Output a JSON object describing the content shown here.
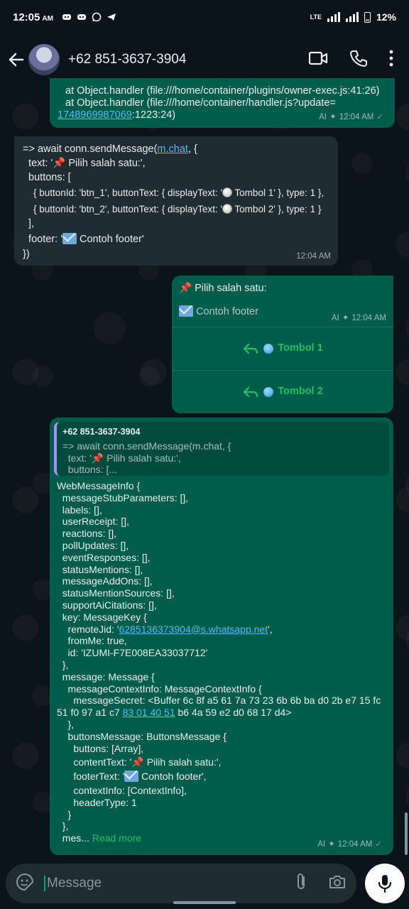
{
  "status_bar": {
    "time": "12:05",
    "ampm": "AM",
    "network": "LTE",
    "battery": "12%"
  },
  "header": {
    "contact": "+62 851-3637-3904"
  },
  "msg1": {
    "lines": [
      "at Object.handler (file:///home/container/plugins/owner-exec.js:41:26)",
      "at Object.handler (file:///home/container/handler.js?update="
    ],
    "link": "1748969987069",
    "suffix": ":1223:24)",
    "ai": "AI",
    "time": "12:04 AM"
  },
  "msg2": {
    "line1_prefix": "=> await conn.sendMessage(",
    "line1_link": "m.chat",
    "line1_suffix": ", {",
    "line2_a": "  text: '",
    "line2_b": " Pilih salah satu:',",
    "line3": "  buttons: [",
    "line4_a": "    { buttonId: 'btn_1', buttonText: { displayText: '",
    "line4_b": " Tombol 1' }, type: 1 },",
    "line5_a": "    { buttonId: 'btn_2', buttonText: { displayText: '",
    "line5_b": " Tombol 2' }, type: 1 }",
    "line6": "  ],",
    "line7_a": "  footer: '",
    "line7_b": " Contoh footer'",
    "line8": "})",
    "time": "12:04 AM"
  },
  "msg3": {
    "text": "Pilih salah satu:",
    "footer": "Contoh footer",
    "ai": "AI",
    "time": "12:04 AM",
    "button1": "Tombol 1",
    "button2": "Tombol 2"
  },
  "msg4": {
    "quote_author": "+62 851-3637-3904",
    "quote_line1": "=> await conn.sendMessage(m.chat, {",
    "quote_line2_a": "  text: '",
    "quote_line2_b": " Pilih salah satu:',",
    "quote_line3": "  buttons: [...",
    "body": [
      "WebMessageInfo {",
      "  messageStubParameters: [],",
      "  labels: [],",
      "  userReceipt: [],",
      "  reactions: [],",
      "  pollUpdates: [],",
      "  eventResponses: [],",
      "  statusMentions: [],",
      "  messageAddOns: [],",
      "  statusMentionSources: [],",
      "  supportAiCitations: [],",
      "  key: MessageKey {"
    ],
    "remote_prefix": "    remoteJid: '",
    "remote_link": "6285136373904@s.whatsapp.net",
    "remote_suffix": "',",
    "body2": [
      "    fromMe: true,",
      "    id: 'IZUMI-F7E008EA33037712'",
      "  },",
      "  message: Message {",
      "    messageContextInfo: MessageContextInfo {",
      "      messageSecret: <Buffer 6c 8f a5 61 7a 73 23 6b 6b ba d0 2b e7 15 fc"
    ],
    "secret_prefix": "51 f0 97 a1 c7 ",
    "secret_link": "83 01 40 51",
    "secret_suffix": " b6 4a 59 e2 d0 68 17 d4>",
    "body3": [
      "    },",
      "    buttonsMessage: ButtonsMessage {",
      "      buttons: [Array],"
    ],
    "content_a": "      contentText: '",
    "content_b": " Pilih salah satu:',",
    "footer_a": "      footerText: '",
    "footer_b": " Contoh footer',",
    "body4": [
      "      contextInfo: [ContextInfo],",
      "      headerType: 1",
      "    }",
      "  },"
    ],
    "last": "  mes...",
    "read_more": "Read more",
    "ai": "AI",
    "time": "12:04 AM"
  },
  "composer": {
    "placeholder": "Message"
  }
}
